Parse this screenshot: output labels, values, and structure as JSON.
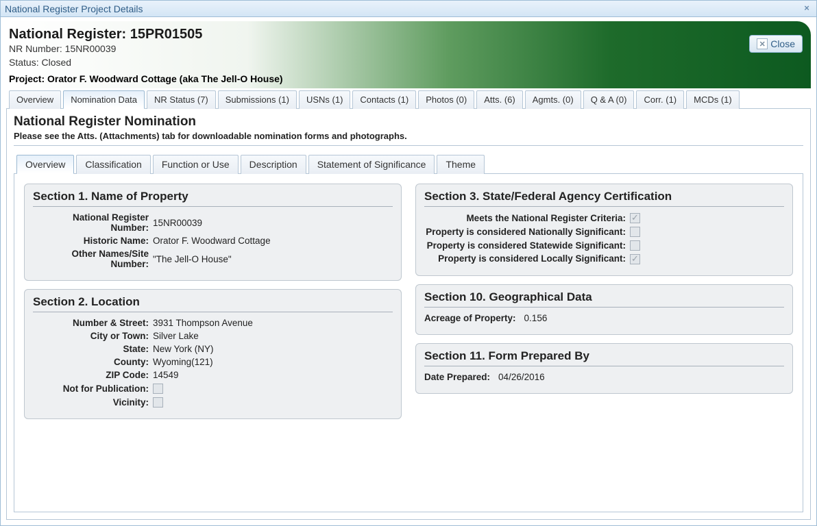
{
  "window": {
    "title": "National Register Project Details",
    "close_label": "Close"
  },
  "header": {
    "main_title": "National Register: 15PR01505",
    "nr_line": "NR Number: 15NR00039",
    "status_line": "Status: Closed",
    "project_line": "Project: Orator F. Woodward Cottage (aka The Jell-O House)"
  },
  "main_tabs": [
    {
      "label": "Overview"
    },
    {
      "label": "Nomination Data"
    },
    {
      "label": "NR Status (7)"
    },
    {
      "label": "Submissions (1)"
    },
    {
      "label": "USNs (1)"
    },
    {
      "label": "Contacts (1)"
    },
    {
      "label": "Photos (0)"
    },
    {
      "label": "Atts. (6)"
    },
    {
      "label": "Agmts. (0)"
    },
    {
      "label": "Q & A (0)"
    },
    {
      "label": "Corr. (1)"
    },
    {
      "label": "MCDs (1)"
    }
  ],
  "nomination": {
    "heading": "National Register Nomination",
    "note": "Please see the Atts. (Attachments) tab for downloadable nomination forms and photographs."
  },
  "sub_tabs": [
    {
      "label": "Overview"
    },
    {
      "label": "Classification"
    },
    {
      "label": "Function or Use"
    },
    {
      "label": "Description"
    },
    {
      "label": "Statement of Significance"
    },
    {
      "label": "Theme"
    }
  ],
  "sections": {
    "s1": {
      "title": "Section 1. Name of Property",
      "rows": [
        {
          "k": "National Register Number:",
          "v": "15NR00039"
        },
        {
          "k": "Historic Name:",
          "v": "Orator F. Woodward Cottage"
        },
        {
          "k": "Other Names/Site Number:",
          "v": "\"The Jell-O House\""
        }
      ]
    },
    "s2": {
      "title": "Section 2. Location",
      "rows": [
        {
          "k": "Number & Street:",
          "v": "3931 Thompson Avenue"
        },
        {
          "k": "City or Town:",
          "v": "Silver Lake"
        },
        {
          "k": "State:",
          "v": "New York (NY)"
        },
        {
          "k": "County:",
          "v": "Wyoming(121)"
        },
        {
          "k": "ZIP Code:",
          "v": "14549"
        }
      ],
      "checks": [
        {
          "k": "Not for Publication:",
          "checked": false
        },
        {
          "k": "Vicinity:",
          "checked": false
        }
      ]
    },
    "s3": {
      "title": "Section 3. State/Federal Agency Certification",
      "checks": [
        {
          "k": "Meets the National Register Criteria:",
          "checked": true
        },
        {
          "k": "Property is considered Nationally Significant:",
          "checked": false
        },
        {
          "k": "Property is considered Statewide Significant:",
          "checked": false
        },
        {
          "k": "Property is considered Locally Significant:",
          "checked": true
        }
      ]
    },
    "s10": {
      "title": "Section 10. Geographical Data",
      "rows": [
        {
          "k": "Acreage of Property:",
          "v": "0.156"
        }
      ]
    },
    "s11": {
      "title": "Section 11. Form Prepared By",
      "rows": [
        {
          "k": "Date Prepared:",
          "v": "04/26/2016"
        }
      ]
    }
  }
}
